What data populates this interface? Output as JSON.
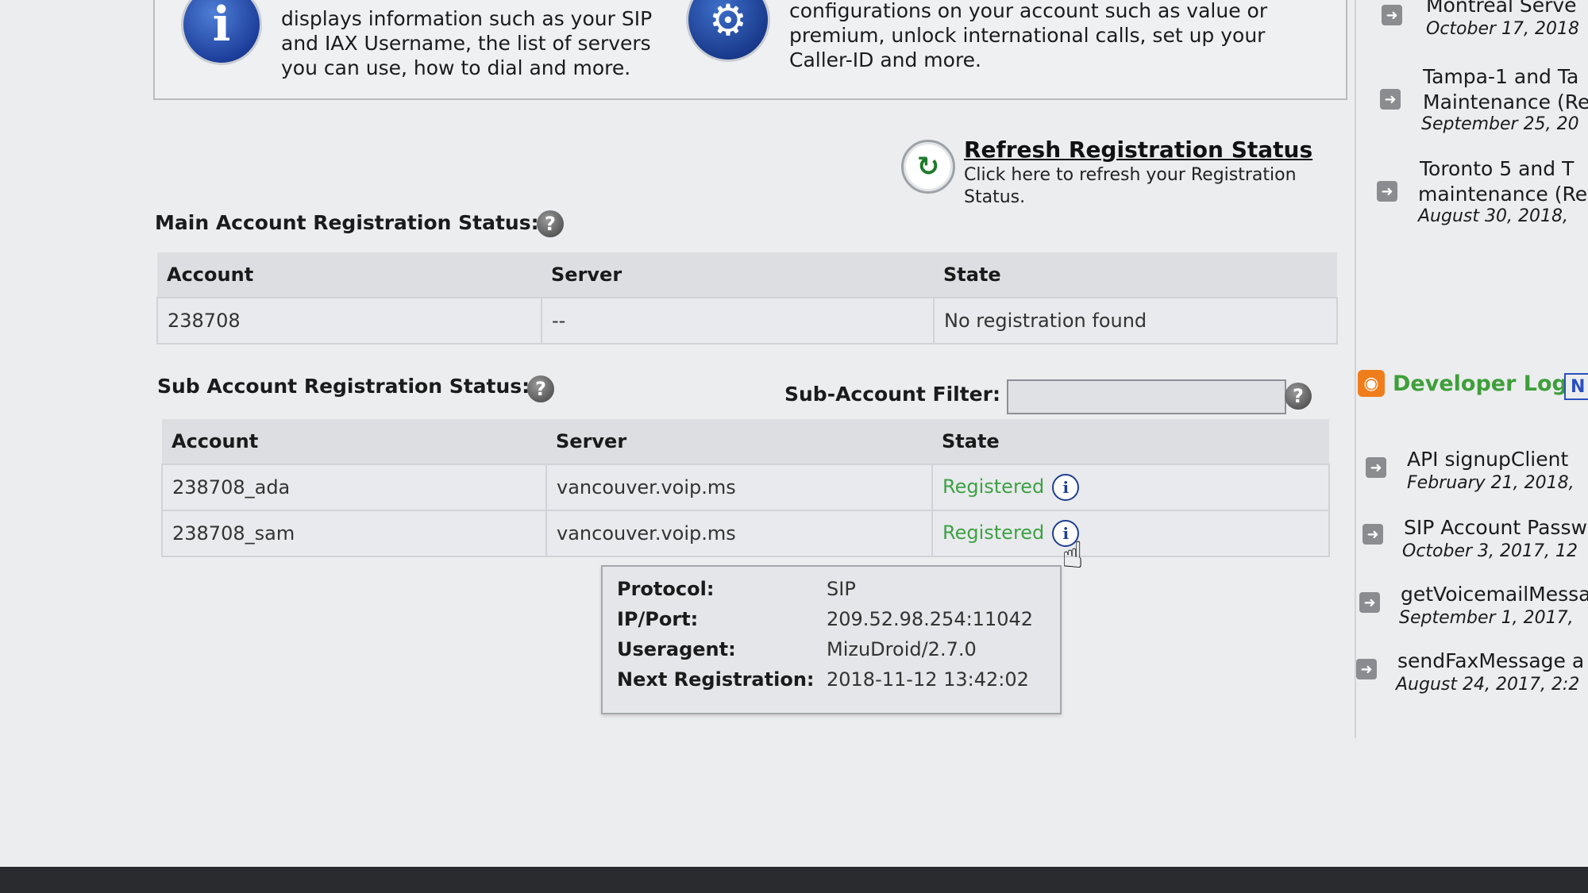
{
  "intro": {
    "info_text": "displays information such as your SIP and IAX Username, the list of servers you can use, how to dial and more.",
    "config_text": "configurations on your account such as value or premium, unlock international calls, set up your Caller-ID and more."
  },
  "refresh": {
    "title": "Refresh Registration Status",
    "description": "Click here to refresh your Registration Status."
  },
  "main_account": {
    "label": "Main Account Registration Status:",
    "columns": [
      "Account",
      "Server",
      "State"
    ],
    "rows": [
      {
        "account": "238708",
        "server": "--",
        "state": "No registration found"
      }
    ]
  },
  "sub_account": {
    "label": "Sub Account Registration Status:",
    "filter_label": "Sub-Account Filter:",
    "filter_value": "",
    "columns": [
      "Account",
      "Server",
      "State"
    ],
    "rows": [
      {
        "account": "238708_ada",
        "server": "vancouver.voip.ms",
        "state": "Registered"
      },
      {
        "account": "238708_sam",
        "server": "vancouver.voip.ms",
        "state": "Registered"
      }
    ]
  },
  "tooltip": {
    "protocol_label": "Protocol:",
    "protocol_value": "SIP",
    "ip_label": "IP/Port:",
    "ip_value": "209.52.98.254:11042",
    "useragent_label": "Useragent:",
    "useragent_value": "MizuDroid/2.7.0",
    "next_label": "Next Registration:",
    "next_value": "2018-11-12 13:42:02"
  },
  "news": [
    {
      "title": "Montreal Serve",
      "date": "October 17, 2018"
    },
    {
      "title": "Tampa-1 and Ta",
      "title2": "Maintenance (Re",
      "date": "September 25, 20"
    },
    {
      "title": "Toronto 5 and T",
      "title2": "maintenance (Re",
      "date": "August 30, 2018, "
    }
  ],
  "developer_log": {
    "title": "Developer Log",
    "badge": "N",
    "items": [
      {
        "title": "API signupClient",
        "date": "February 21, 2018,"
      },
      {
        "title": "SIP Account Passw",
        "date": "October 3, 2017, 12"
      },
      {
        "title": "getVoicemailMessa",
        "date": "September 1, 2017, "
      },
      {
        "title": "sendFaxMessage a",
        "date": "August 24, 2017, 2:2"
      }
    ]
  },
  "colors": {
    "error": "#d0213b",
    "ok": "#3ea145",
    "devlog": "#3e9f3a",
    "rss": "#f07d1b"
  },
  "icons": {
    "info": "info-icon",
    "config": "gear-icon",
    "refresh": "refresh-icon",
    "help": "help-icon",
    "details": "info-circle-icon",
    "cursor": "hand-pointer-icon",
    "rss": "rss-icon",
    "bullet": "arrow-bullet-icon"
  }
}
